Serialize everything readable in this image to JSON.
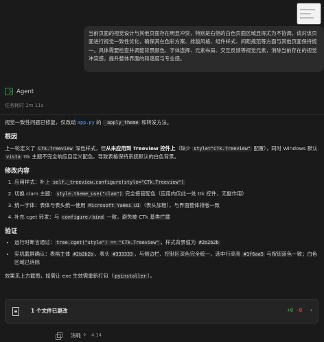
{
  "user_message": "当前页面的视觉设计与其他页面存在明显冲突，特别是右侧的白色页面区域显得尤为不协调。请对该页面进行视觉一致性优化，确保其在色彩方案、排版风格、组件样式、间距规范等方面与其他页面保持统一。具体需要检查并调整背景颜色、字体选择、元素布局、交互反馈等视觉元素，消除当前存在的视觉冲突感，提升整体界面的和谐度与专业感。",
  "agent": {
    "label": "Agent",
    "elapsed": "任务耗时 2m 11s"
  },
  "summary": {
    "pre": "视觉一致性问题已修复，仅改动 ",
    "file": "app.py",
    "mid": " 的 ",
    "fn": "_apply_theme",
    "post": " 和转发方法。"
  },
  "sections": {
    "root_cause": "根因",
    "fix": "修改内容",
    "verify": "验证"
  },
  "root_cause_text": {
    "a": "上一轮定义了 ",
    "code1": "CTk.Treeview",
    "b": " 深色样式，但",
    "bold": "从未应用到 Treeview 控件上",
    "c": "（缺少 ",
    "code2": "style=\"CTk.Treeview\"",
    "d": " 配置），同时 Windows 默认 ",
    "code3": "vista",
    "e": " ttk 主题不完全响应自定义配色，导致表格保持系统默认的白色背景。"
  },
  "fix_items": [
    {
      "label": "应用样式：补上 ",
      "code": "self._treeview.configure(style=\"CTk.Treeview\")",
      "rest": ""
    },
    {
      "label": "切换 clam 主题：",
      "code": "style.theme_use(\"clam\")",
      "rest": " 完全接管配色（应用内仅此一处 ttk 控件，无副作用）"
    },
    {
      "label": "统一字体：表体与表头统一使用 ",
      "code": "Microsoft YaHei UI",
      "rest": "（表头加粗），与界面整体排版一致"
    },
    {
      "label": "补充 cget 转发：与 ",
      "code": "configure",
      "sep": "/",
      "code_b": "bind",
      "rest": " 一致，避免被 CTk 基类拦截"
    }
  ],
  "verify_items": [
    {
      "a": "运行时断言通过：",
      "code1": "tree.cget(\"style\") == \"CTk.Treeview\"",
      "b": "，样式背景值为 ",
      "code2": "#2b2b2b"
    },
    {
      "a": "实机截屏确认：表格主体 ",
      "code1": "#2b2b2b",
      "b": "、表头 ",
      "code2": "#333333",
      "c": "，与侧边栏、控制区深色完全统一，选中行高亮 ",
      "code3": "#1f6aa5",
      "d": " 与按钮蓝色一致；白色区域已消除"
    }
  ],
  "closing": {
    "a": "效果见上方截图，如需让 exe 生效需重新打包（",
    "code": "pyinstaller",
    "b": "）。"
  },
  "changes": {
    "label": "1 个文件已更改",
    "plus": "+0",
    "minus": "-0"
  },
  "footer": {
    "label": "消耗",
    "model": "4.14"
  }
}
